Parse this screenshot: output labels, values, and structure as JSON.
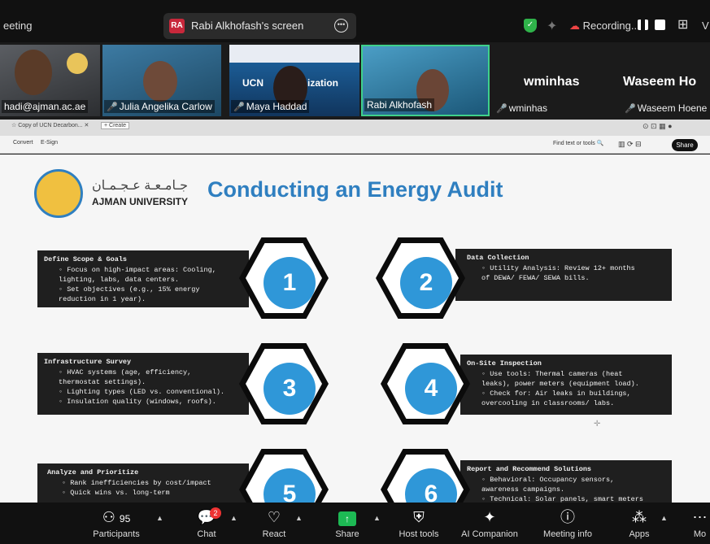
{
  "meeting": {
    "title": "eeting",
    "share_label": "Rabi Alkhofash's screen",
    "share_initials": "RA",
    "recording": "Recording..."
  },
  "participants": [
    {
      "name": "hadi@ajman.ac.ae"
    },
    {
      "name": "Julia Angelika Carlow"
    },
    {
      "name": "Maya Haddad"
    },
    {
      "name": "Rabi Alkhofash"
    },
    {
      "name": "wminhas",
      "big": "wminhas"
    },
    {
      "name": "Waseem Hoene",
      "big": "Waseem Ho"
    }
  ],
  "slide_thumb_text": {
    "left": "UCN",
    "right": "ization"
  },
  "browser": {
    "tab": "Copy of UCN Decarbon...",
    "new_tab": "+ Create",
    "convert": "Convert",
    "esign": "E-Sign",
    "find": "Find text or tools",
    "share": "Share"
  },
  "slide": {
    "title": "Conducting an Energy Audit",
    "logo_ar": "جـامـعـة عـجـمـان",
    "logo_en": "AJMAN UNIVERSITY",
    "steps": [
      {
        "number": "1",
        "title": "Define Scope & Goals",
        "bullets": [
          "Focus on high-impact areas: Cooling,",
          "lighting, labs, data centers.",
          "Set objectives (e.g., 15% energy",
          "reduction in 1 year)."
        ]
      },
      {
        "number": "2",
        "title": "Data Collection",
        "bullets": [
          "Utility Analysis: Review 12+ months",
          "of DEWA/ FEWA/ SEWA bills."
        ]
      },
      {
        "number": "3",
        "title": "Infrastructure Survey",
        "bullets": [
          "HVAC systems (age, efficiency,",
          "thermostat settings).",
          "Lighting types (LED vs. conventional).",
          "Insulation quality (windows, roofs)."
        ]
      },
      {
        "number": "4",
        "title": "On-Site Inspection",
        "bullets": [
          "Use tools: Thermal cameras (heat",
          "leaks), power meters (equipment load).",
          "Check for: Air leaks in buildings,",
          "overcooling in classrooms/ labs."
        ]
      },
      {
        "number": "5",
        "title": "Analyze and Prioritize",
        "bullets": [
          "Rank inefficiencies by cost/impact",
          "Quick wins vs. long-term"
        ]
      },
      {
        "number": "6",
        "title": "Report and Recommend Solutions",
        "bullets": [
          "Behavioral: Occupancy sensors,",
          "awareness campaigns.",
          "Technical: Solar panels, smart meters"
        ]
      }
    ]
  },
  "toolbar": {
    "participants_count": "95",
    "chat_badge": "2",
    "items": [
      {
        "label": "Participants",
        "icon": "people-icon"
      },
      {
        "label": "Chat",
        "icon": "chat-icon"
      },
      {
        "label": "React",
        "icon": "heart-icon"
      },
      {
        "label": "Share",
        "icon": "share-icon"
      },
      {
        "label": "Host tools",
        "icon": "shield-icon"
      },
      {
        "label": "AI Companion",
        "icon": "sparkle-icon"
      },
      {
        "label": "Meeting info",
        "icon": "info-icon"
      },
      {
        "label": "Apps",
        "icon": "apps-icon"
      },
      {
        "label": "Mo",
        "icon": "more-icon"
      }
    ]
  }
}
